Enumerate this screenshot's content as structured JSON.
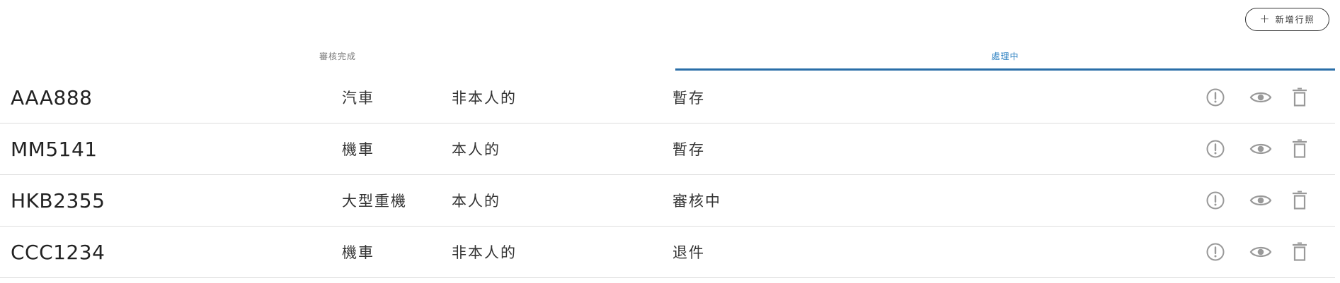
{
  "header": {
    "add_button_label": "新增行照",
    "add_button_icon": "plus-icon"
  },
  "tabs": [
    {
      "label": "審核完成",
      "active": false
    },
    {
      "label": "處理中",
      "active": true
    }
  ],
  "colors": {
    "active_tab": "#2a7fc1",
    "indicator": "#2a6ea8",
    "icon": "#999999",
    "divider": "#dedede"
  },
  "rows": [
    {
      "plate": "AAA888",
      "vehicle_type": "汽車",
      "owner": "非本人的",
      "status": "暫存"
    },
    {
      "plate": "MM5141",
      "vehicle_type": "機車",
      "owner": "本人的",
      "status": "暫存"
    },
    {
      "plate": "HKB2355",
      "vehicle_type": "大型重機",
      "owner": "本人的",
      "status": "審核中"
    },
    {
      "plate": "CCC1234",
      "vehicle_type": "機車",
      "owner": "非本人的",
      "status": "退件"
    }
  ],
  "row_actions": [
    "info-icon",
    "eye-icon",
    "trash-icon"
  ]
}
